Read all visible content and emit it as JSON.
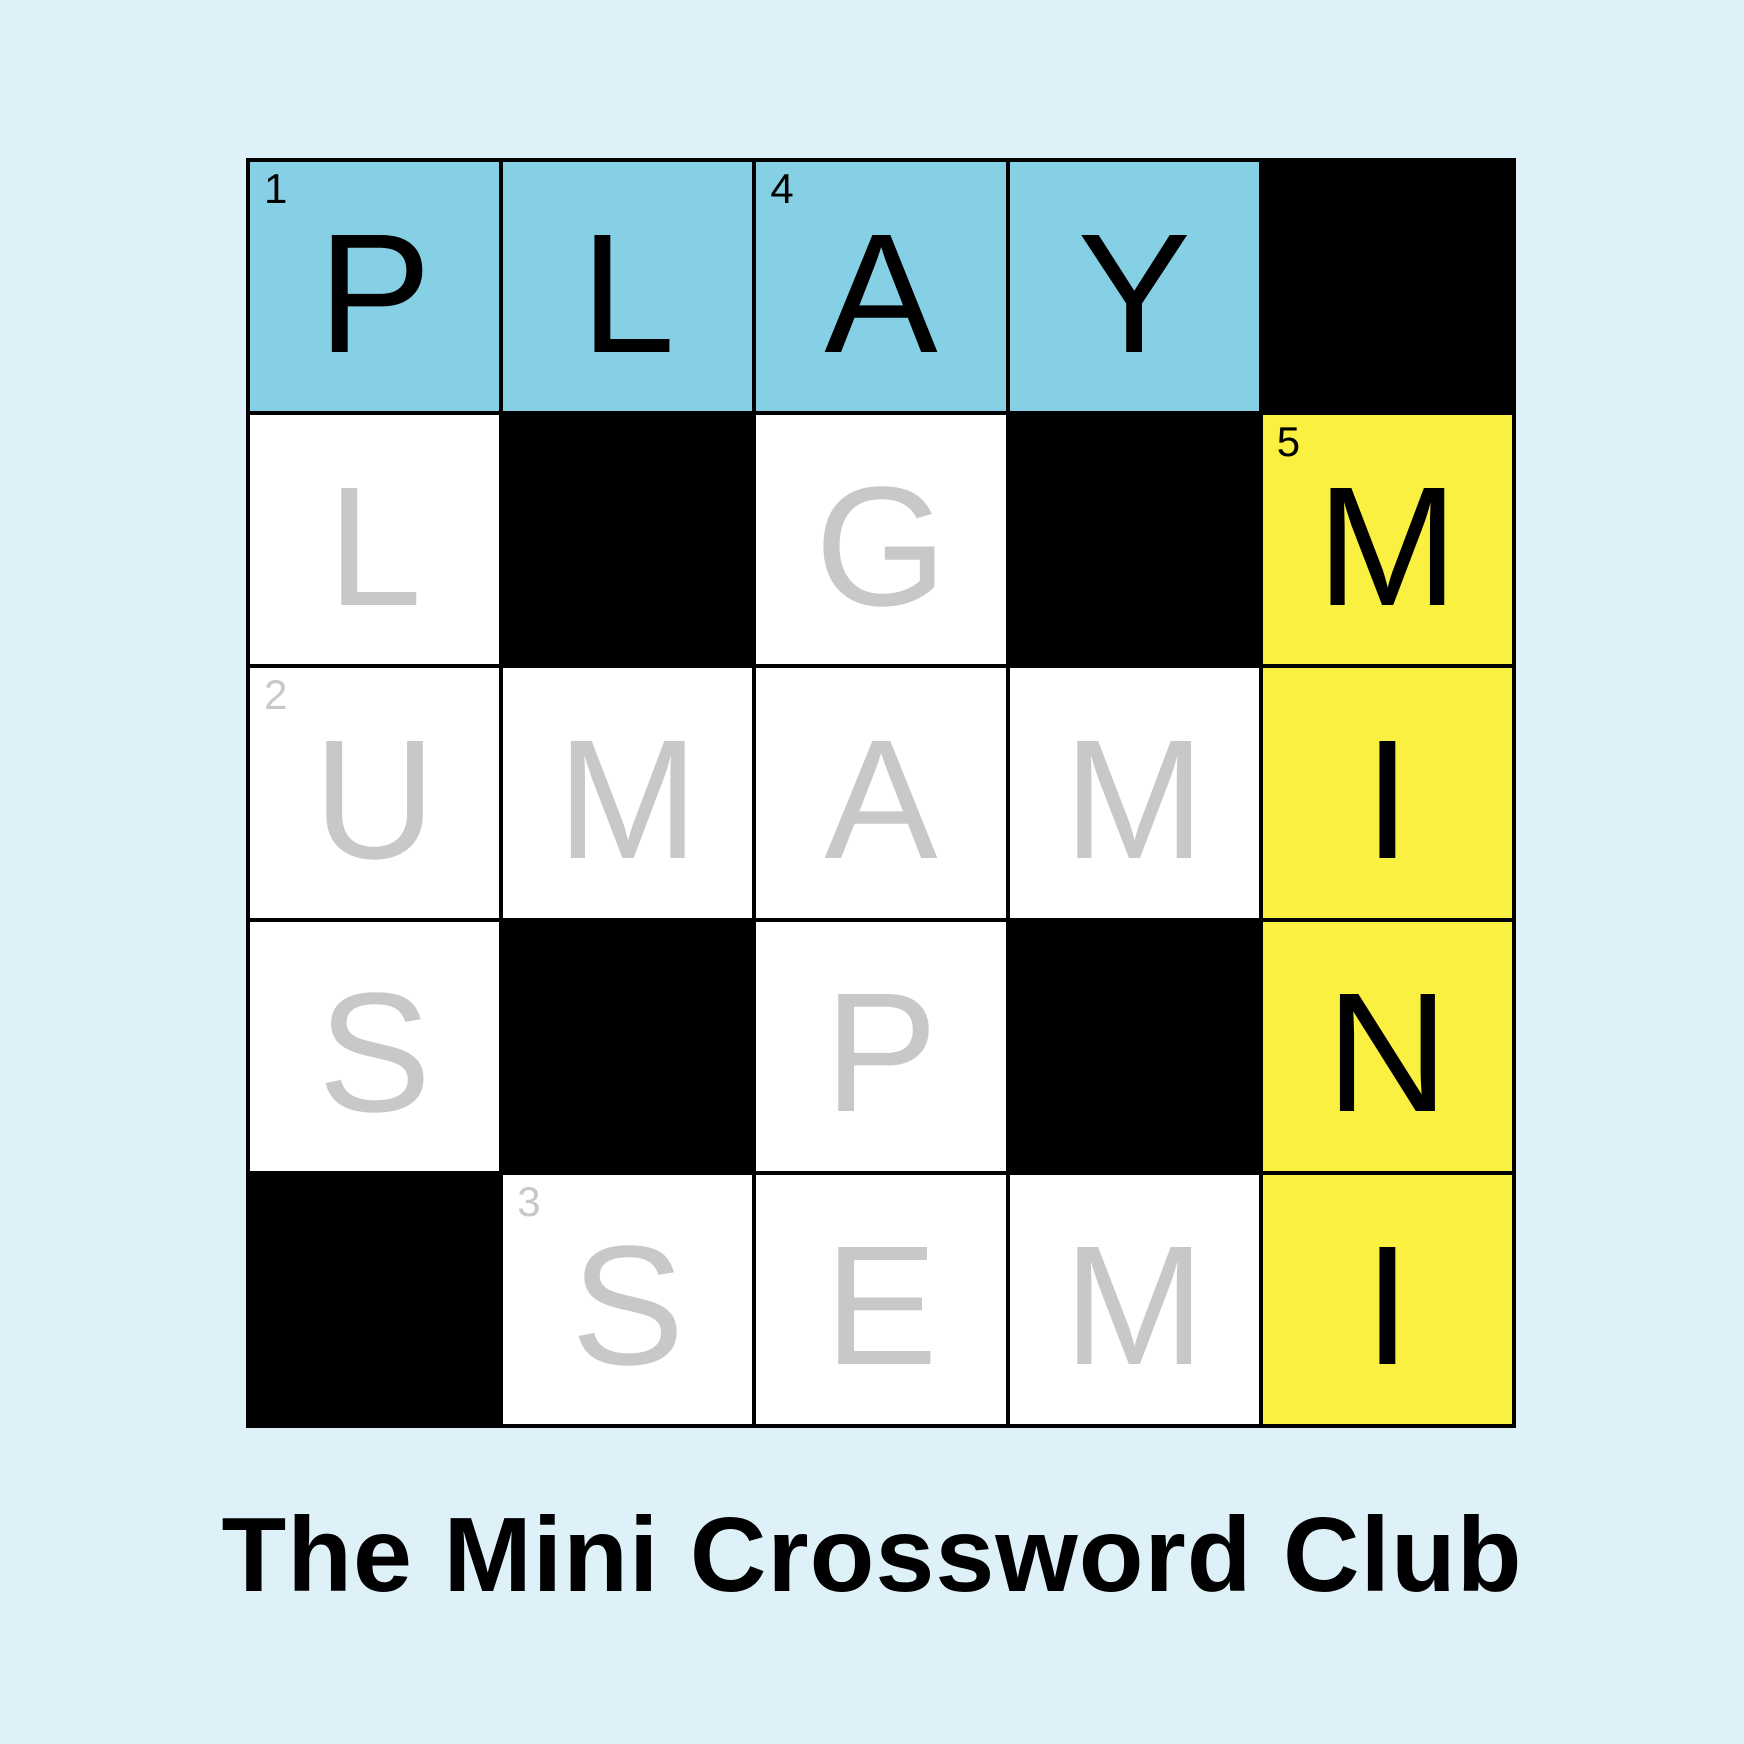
{
  "colors": {
    "background": "#dff1f8",
    "across_highlight": "#86d0e5",
    "down_highlight": "#f9f042",
    "block": "#000000",
    "empty": "#ffffff",
    "filled_letter": "#000000",
    "hint_letter": "#c8c8c8"
  },
  "grid": [
    [
      {
        "letter": "P",
        "number": "1",
        "state": "across",
        "hint": false
      },
      {
        "letter": "L",
        "number": "",
        "state": "across",
        "hint": false
      },
      {
        "letter": "A",
        "number": "4",
        "state": "across",
        "hint": false
      },
      {
        "letter": "Y",
        "number": "",
        "state": "across",
        "hint": false
      },
      {
        "letter": "",
        "number": "",
        "state": "block",
        "hint": false
      }
    ],
    [
      {
        "letter": "L",
        "number": "",
        "state": "empty",
        "hint": true
      },
      {
        "letter": "",
        "number": "",
        "state": "block",
        "hint": false
      },
      {
        "letter": "G",
        "number": "",
        "state": "empty",
        "hint": true
      },
      {
        "letter": "",
        "number": "",
        "state": "block",
        "hint": false
      },
      {
        "letter": "M",
        "number": "5",
        "state": "down",
        "hint": false
      }
    ],
    [
      {
        "letter": "U",
        "number": "2",
        "state": "empty",
        "hint": true
      },
      {
        "letter": "M",
        "number": "",
        "state": "empty",
        "hint": true
      },
      {
        "letter": "A",
        "number": "",
        "state": "empty",
        "hint": true
      },
      {
        "letter": "M",
        "number": "",
        "state": "empty",
        "hint": true
      },
      {
        "letter": "I",
        "number": "",
        "state": "down",
        "hint": false
      }
    ],
    [
      {
        "letter": "S",
        "number": "",
        "state": "empty",
        "hint": true
      },
      {
        "letter": "",
        "number": "",
        "state": "block",
        "hint": false
      },
      {
        "letter": "P",
        "number": "",
        "state": "empty",
        "hint": true
      },
      {
        "letter": "",
        "number": "",
        "state": "block",
        "hint": false
      },
      {
        "letter": "N",
        "number": "",
        "state": "down",
        "hint": false
      }
    ],
    [
      {
        "letter": "",
        "number": "",
        "state": "block",
        "hint": false
      },
      {
        "letter": "S",
        "number": "3",
        "state": "empty",
        "hint": true
      },
      {
        "letter": "E",
        "number": "",
        "state": "empty",
        "hint": true
      },
      {
        "letter": "M",
        "number": "",
        "state": "empty",
        "hint": true
      },
      {
        "letter": "I",
        "number": "",
        "state": "down",
        "hint": false
      }
    ]
  ],
  "footer": {
    "title": "The Mini Crossword Club"
  }
}
